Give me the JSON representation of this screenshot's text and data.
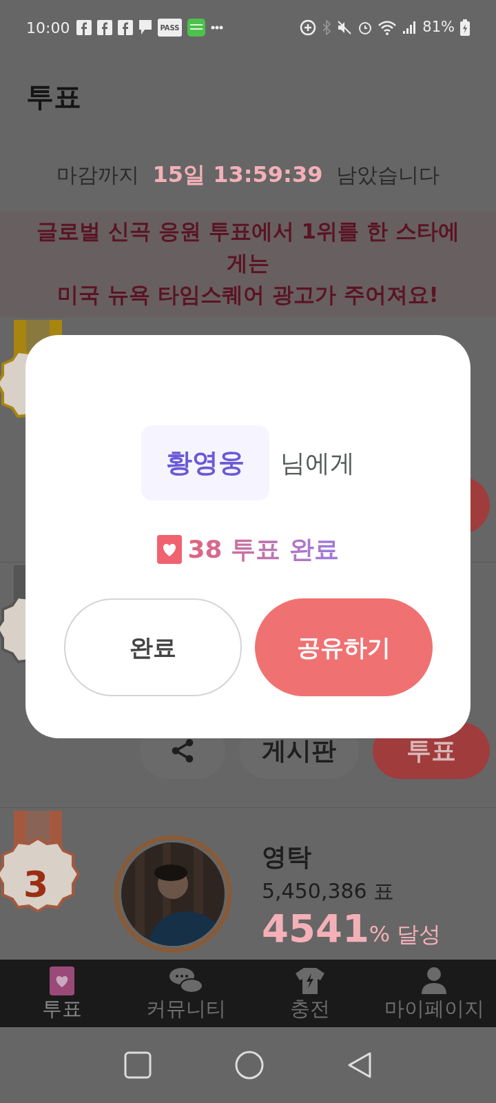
{
  "status_bar": {
    "time": "10:00",
    "pass_badge": "PASS",
    "battery": "81%"
  },
  "header": {
    "title": "투표"
  },
  "countdown": {
    "prefix": "마감까지",
    "time": "15일 13:59:39",
    "suffix": "남았습니다"
  },
  "banner": {
    "lines": [
      "글로벌 신곡 응원 투표에서 1위를 한 스타에",
      "게는",
      "미국 뉴욕 타임스퀘어 광고가 주어져요!"
    ]
  },
  "rankings": [
    {
      "color": "#a7850f",
      "buttons": [
        {
          "kind": "vote"
        }
      ]
    },
    {
      "color": "#555555",
      "buttons": [
        {
          "kind": "share"
        },
        {
          "kind": "board",
          "label": "게시판"
        },
        {
          "kind": "vote",
          "label": "투표"
        }
      ]
    },
    {
      "color": "#a4593e",
      "rank": "3",
      "name": "영탁",
      "votes": "5,450,386 표",
      "percent": "4541",
      "percent_suffix": "% 달성"
    }
  ],
  "dialog": {
    "name": "황영웅",
    "name_suffix": "님에게",
    "result": "38 투표 완료",
    "buttons": [
      {
        "label": "완료",
        "kind": "outline"
      },
      {
        "label": "공유하기",
        "kind": "primary"
      }
    ]
  },
  "bottom_nav": [
    {
      "label": "투표",
      "kind": "vote",
      "selected": true
    },
    {
      "label": "커뮤니티",
      "kind": "community",
      "selected": false
    },
    {
      "label": "충전",
      "kind": "charge",
      "selected": false
    },
    {
      "label": "마이페이지",
      "kind": "mypage",
      "selected": false
    }
  ]
}
